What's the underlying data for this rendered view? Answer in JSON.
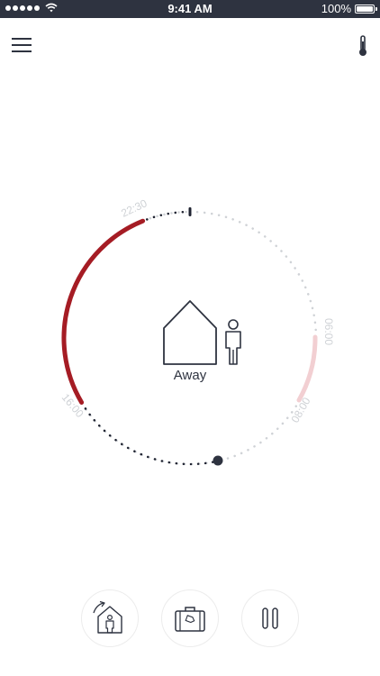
{
  "status_bar": {
    "time": "9:41 AM",
    "battery": "100%",
    "signal_icon": "signal-dots-icon",
    "wifi_icon": "wifi-icon"
  },
  "header": {
    "menu_icon": "hamburger-menu-icon",
    "temperature_icon": "thermometer-icon"
  },
  "schedule": {
    "ticks": [
      "22:30",
      "06:00",
      "08:00",
      "16:00"
    ],
    "mode": "Away",
    "colors": {
      "active_heat": "#a51c24",
      "light_heat": "#f2cfd2",
      "track_dark": "#1e2230",
      "track_light": "#cfd2d6"
    }
  },
  "actions": {
    "home_icon": "home-arrival-icon",
    "away_icon": "suitcase-icon",
    "pause_icon": "pause-icon"
  }
}
